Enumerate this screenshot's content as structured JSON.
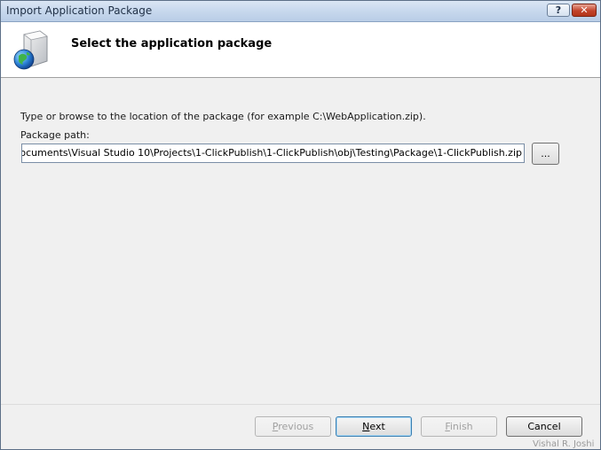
{
  "window": {
    "title": "Import Application Package",
    "help_label": "?",
    "close_label": "✕"
  },
  "header": {
    "title": "Select the application package",
    "icon": "package-globe-icon"
  },
  "body": {
    "description": "Type or browse to the location of the package (for example C:\\WebApplication.zip).",
    "path_label": "Package path:",
    "path_value": "ocuments\\Visual Studio 10\\Projects\\1-ClickPublish\\1-ClickPublish\\obj\\Testing\\Package\\1-ClickPublish.zip",
    "browse_label": "..."
  },
  "buttons": {
    "previous": {
      "mnemonic": "P",
      "rest": "revious"
    },
    "next": {
      "mnemonic": "N",
      "rest": "ext"
    },
    "finish": {
      "mnemonic": "F",
      "rest": "inish"
    },
    "cancel": "Cancel"
  },
  "watermark": "Vishal R. Joshi"
}
